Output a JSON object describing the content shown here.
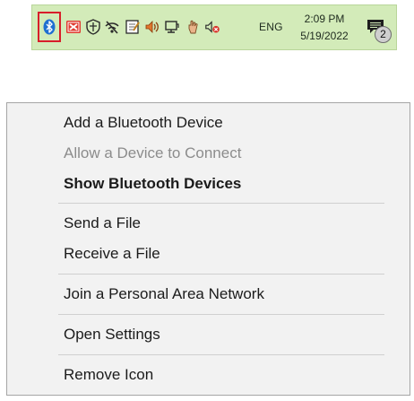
{
  "taskbar": {
    "tray_icons": [
      "bluetooth-icon",
      "red-app-icon",
      "security-shield-icon",
      "network-off-icon",
      "notepad-icon",
      "speaker-icon",
      "display-icon",
      "touch-hand-icon",
      "volume-muted-icon"
    ],
    "language": "ENG",
    "time": "2:09 PM",
    "date": "5/19/2022",
    "notification_count": "2",
    "highlight_color": "#d81e2a",
    "background_color": "#d3ebb9"
  },
  "menu": {
    "items": [
      {
        "label": "Add a Bluetooth Device",
        "state": "enabled"
      },
      {
        "label": "Allow a Device to Connect",
        "state": "disabled"
      },
      {
        "label": "Show Bluetooth Devices",
        "state": "default-bold"
      },
      {
        "label": "Send a File",
        "state": "enabled"
      },
      {
        "label": "Receive a File",
        "state": "enabled"
      },
      {
        "label": "Join a Personal Area Network",
        "state": "enabled"
      },
      {
        "label": "Open Settings",
        "state": "enabled"
      },
      {
        "label": "Remove Icon",
        "state": "enabled"
      }
    ]
  }
}
